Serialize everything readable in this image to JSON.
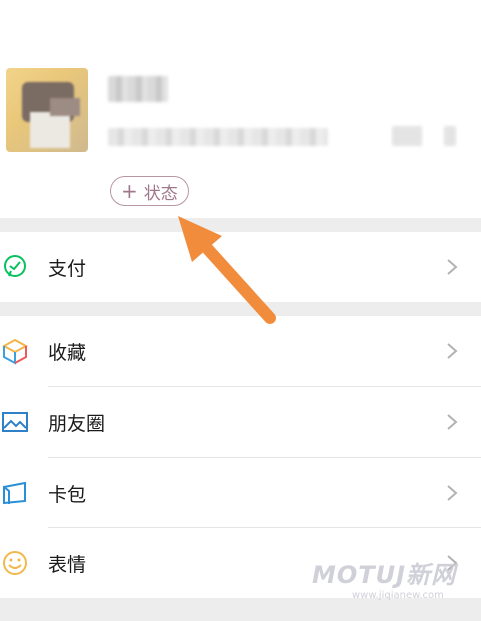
{
  "profile": {
    "status_plus": "+",
    "status_label": "状态"
  },
  "menu": {
    "items": [
      {
        "label": "支付",
        "icon": "wechat-pay-icon",
        "color": "#07c160"
      },
      {
        "label": "收藏",
        "icon": "favorites-cube-icon",
        "color": "#f1b54a"
      },
      {
        "label": "朋友圈",
        "icon": "moments-picture-icon",
        "color": "#2f80c8"
      },
      {
        "label": "卡包",
        "icon": "card-wallet-icon",
        "color": "#2b8fd6"
      },
      {
        "label": "表情",
        "icon": "emoji-smile-icon",
        "color": "#f1b84a"
      }
    ]
  },
  "watermark": {
    "brand": "MOTUJ新网",
    "url": "www.jiqianew.com"
  },
  "colors": {
    "arrow": "#f08c3c",
    "status_border": "#b896a6",
    "separator": "#ededed"
  }
}
